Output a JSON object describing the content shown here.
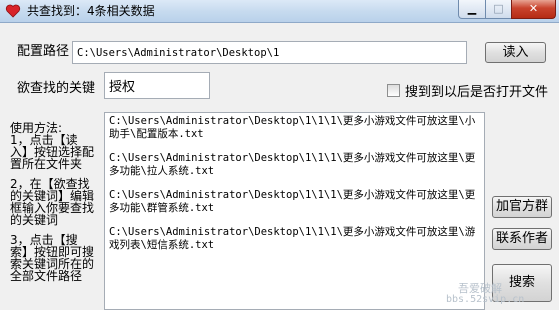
{
  "window": {
    "title": "共查找到：4条相关数据",
    "minimize": "▁",
    "maximize": "□",
    "close": "✕"
  },
  "config": {
    "path_label": "配置路径",
    "path_value": "C:\\Users\\Administrator\\Desktop\\1",
    "read_button": "读入"
  },
  "search": {
    "label": "欲查找的关键",
    "keyword": "授权",
    "open_after_checkbox": "搜到到以后是否打开文件",
    "open_after_checked": false
  },
  "help": {
    "lines": [
      "使用方法:\n1，点击【读\n入】按钮选择配\n置所在文件夹",
      "2，在【欲查找\n的关键词】编辑\n框输入你要查找\n的关键词",
      "3，点击【搜\n索】按钮即可搜\n索关键词所在的\n全部文件路径"
    ]
  },
  "results": [
    "C:\\Users\\Administrator\\Desktop\\1\\1\\1\\更多小游戏文件可放这里\\小助手\\配置版本.txt",
    "C:\\Users\\Administrator\\Desktop\\1\\1\\1\\更多小游戏文件可放这里\\更多功能\\拉人系统.txt",
    "C:\\Users\\Administrator\\Desktop\\1\\1\\1\\更多小游戏文件可放这里\\更多功能\\群管系统.txt",
    "C:\\Users\\Administrator\\Desktop\\1\\1\\1\\更多小游戏文件可放这里\\游戏列表\\短信系统.txt"
  ],
  "buttons": {
    "add_group": "加官方群",
    "contact": "联系作者",
    "search": "搜索"
  },
  "watermark": {
    "logo": "吾爱破解",
    "url": "bbs.52svip.cn"
  }
}
